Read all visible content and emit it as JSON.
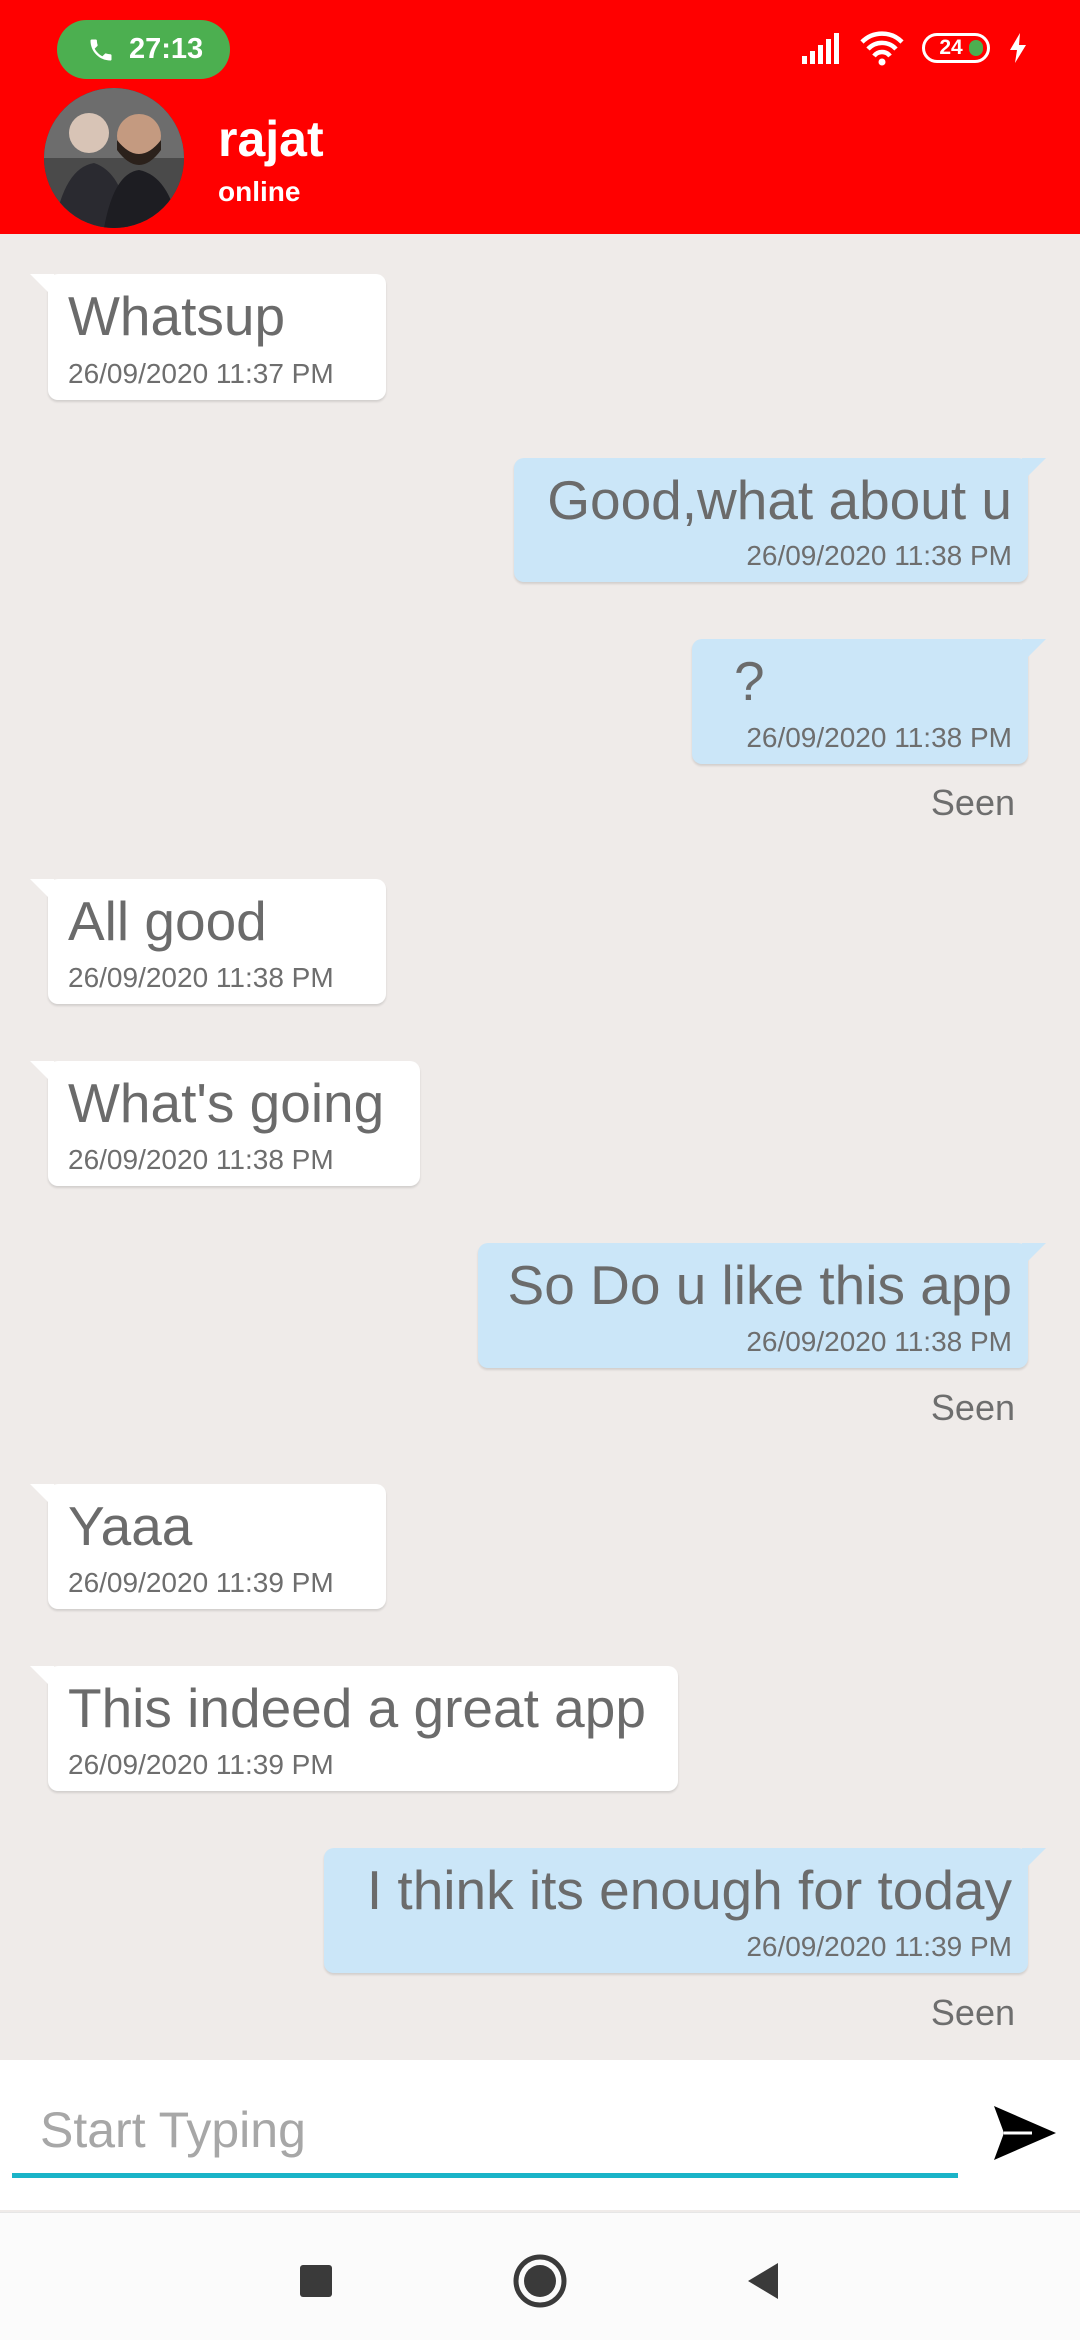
{
  "status_bar": {
    "call_timer": "27:13",
    "battery": "24"
  },
  "header": {
    "contact_name": "rajat",
    "contact_status": "online"
  },
  "messages": [
    {
      "direction": "in",
      "text": "Whatsup",
      "time": "26/09/2020 11:37 PM"
    },
    {
      "direction": "out",
      "text": "Good,what about u",
      "time": "26/09/2020 11:38 PM"
    },
    {
      "direction": "out",
      "text": "?",
      "time": "26/09/2020 11:38 PM",
      "seen": "Seen"
    },
    {
      "direction": "in",
      "text": "All good",
      "time": "26/09/2020 11:38 PM"
    },
    {
      "direction": "in",
      "text": "What's going",
      "time": "26/09/2020 11:38 PM"
    },
    {
      "direction": "out",
      "text": "So Do u like this app",
      "time": "26/09/2020 11:38 PM",
      "seen": "Seen"
    },
    {
      "direction": "in",
      "text": "Yaaa",
      "time": "26/09/2020 11:39 PM"
    },
    {
      "direction": "in",
      "text": "This indeed a great app",
      "time": "26/09/2020 11:39 PM"
    },
    {
      "direction": "out",
      "text": "I think its enough for today",
      "time": "26/09/2020 11:39 PM",
      "seen": "Seen"
    }
  ],
  "composer": {
    "placeholder": "Start Typing"
  },
  "colors": {
    "header_bg": "#ff0000",
    "chat_bg": "#efebe9",
    "incoming_bubble": "#ffffff",
    "outgoing_bubble": "#cbe6f8",
    "input_underline": "#1ab4c8",
    "call_pill": "#4caf50"
  },
  "icons": {
    "call": "phone-icon",
    "signal": "signal-icon",
    "wifi": "wifi-icon",
    "charging": "charging-icon",
    "send": "send-icon",
    "nav_recents": "square-nav-icon",
    "nav_home": "circle-nav-icon",
    "nav_back": "triangle-back-icon"
  }
}
